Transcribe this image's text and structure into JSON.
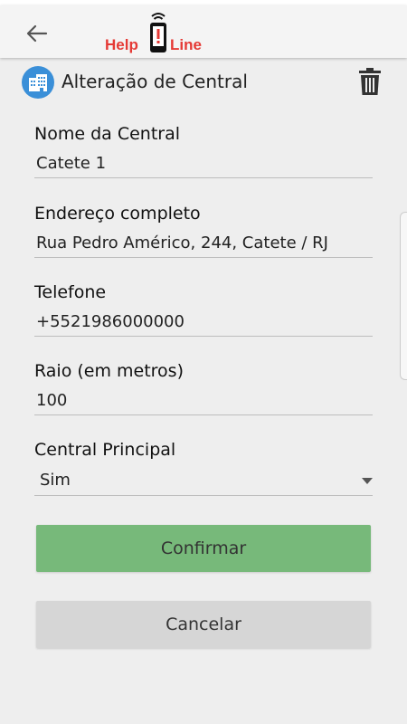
{
  "app": {
    "logo_left": "Help",
    "logo_right": "Line"
  },
  "header": {
    "title": "Alteração de Central"
  },
  "form": {
    "nome": {
      "label": "Nome da Central",
      "value": "Catete 1"
    },
    "endereco": {
      "label": "Endereço completo",
      "value": "Rua Pedro Américo, 244, Catete / RJ"
    },
    "telefone": {
      "label": "Telefone",
      "value": "+5521986000000"
    },
    "raio": {
      "label": "Raio (em metros)",
      "value": "100"
    },
    "principal": {
      "label": "Central Principal",
      "selected": "Sim"
    }
  },
  "buttons": {
    "confirm": "Confirmar",
    "cancel": "Cancelar"
  },
  "colors": {
    "confirm": "#77b97a",
    "cancel": "#d6d6d6",
    "logo": "#e53935",
    "building_icon": "#3a8fd8"
  }
}
